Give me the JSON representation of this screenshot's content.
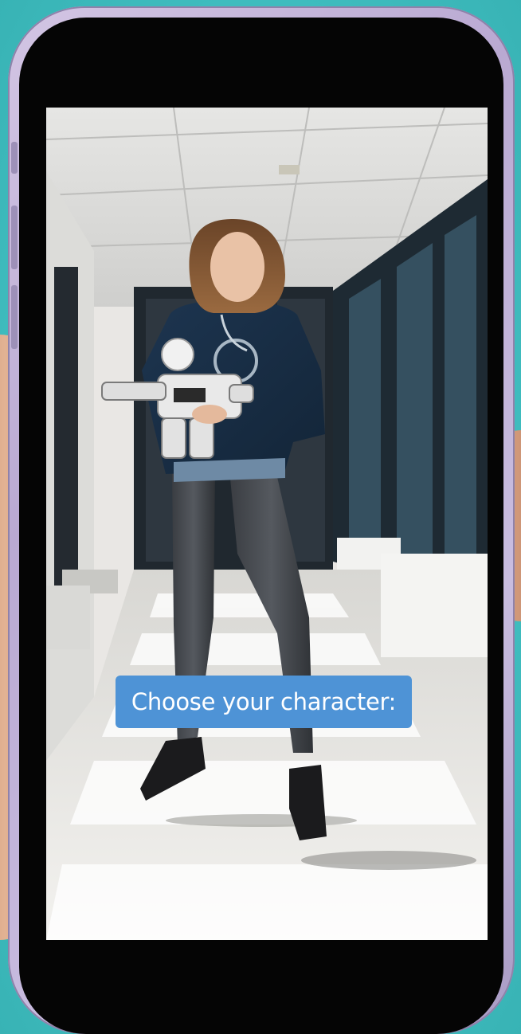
{
  "screen": {
    "caption": "Choose your character:"
  },
  "scene": {
    "subject": "woman-holding-robot",
    "setting": "office-hallway"
  },
  "colors": {
    "background": "#43c1c4",
    "phone_frame": "#c4b7dc",
    "caption_bg": "#4e93d6",
    "caption_text": "#ffffff"
  }
}
